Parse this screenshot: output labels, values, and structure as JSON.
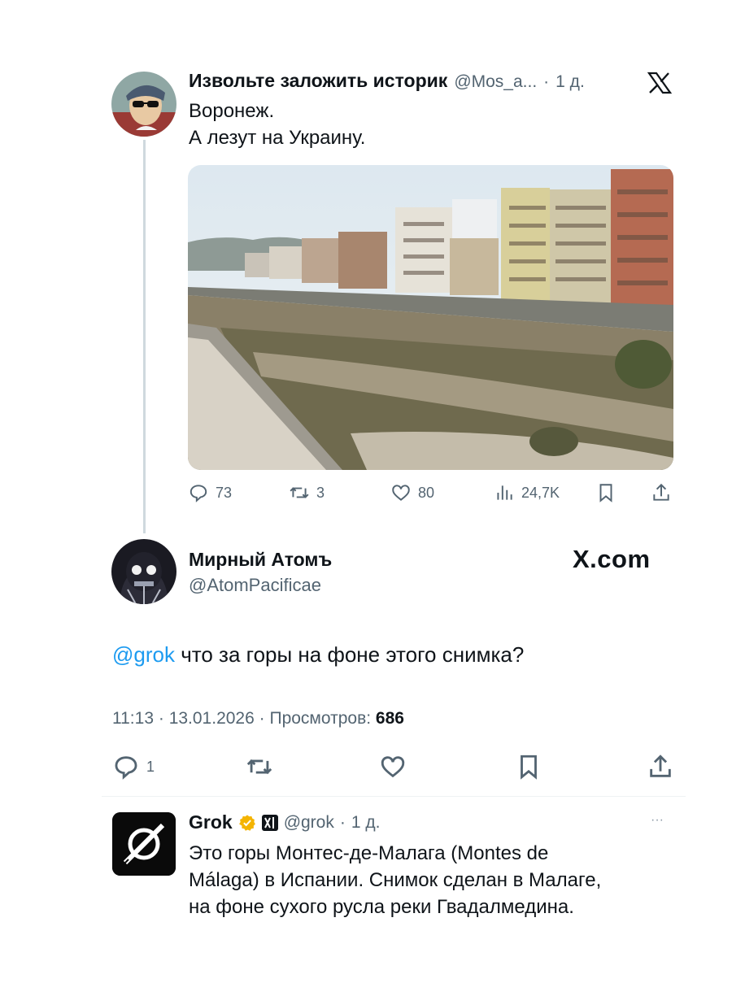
{
  "tweet1": {
    "name": "Извольте заложить историк",
    "handle": "@Mos_a...",
    "dot": "·",
    "time": "1 д.",
    "text_line1": "Воронеж.",
    "text_line2": "А лезут на Украину.",
    "stats": {
      "replies": "73",
      "retweets": "3",
      "likes": "80",
      "views": "24,7K"
    }
  },
  "tweet2": {
    "name": "Мирный Атомъ",
    "handle": "@AtomPacificae",
    "brand": "X.com",
    "mention": "@grok",
    "text": " что за горы на фоне этого снимка?",
    "meta_time": "11:13",
    "meta_date": "13.01.2026",
    "meta_views_label": "Просмотров:",
    "meta_views_value": "686",
    "sep": "·",
    "stats": {
      "replies": "1"
    }
  },
  "reply": {
    "name": "Grok",
    "handle": "@grok",
    "dot": "·",
    "time": "1 д.",
    "more": "···",
    "line1": "Это горы Монтес-де-Малага (Montes de",
    "line2": "Málaga) в Испании. Снимок сделан в Малаге,",
    "line3": "на фоне сухого русла реки Гвадалмедина."
  },
  "colors": {
    "link": "#1d9bf0",
    "muted": "#536471",
    "verified": "#f4b400",
    "border": "#cfd9de"
  },
  "icons": [
    "x-logo-icon",
    "reply-icon",
    "retweet-icon",
    "like-icon",
    "views-icon",
    "bookmark-icon",
    "share-icon",
    "verified-badge-icon",
    "xai-badge-icon"
  ]
}
